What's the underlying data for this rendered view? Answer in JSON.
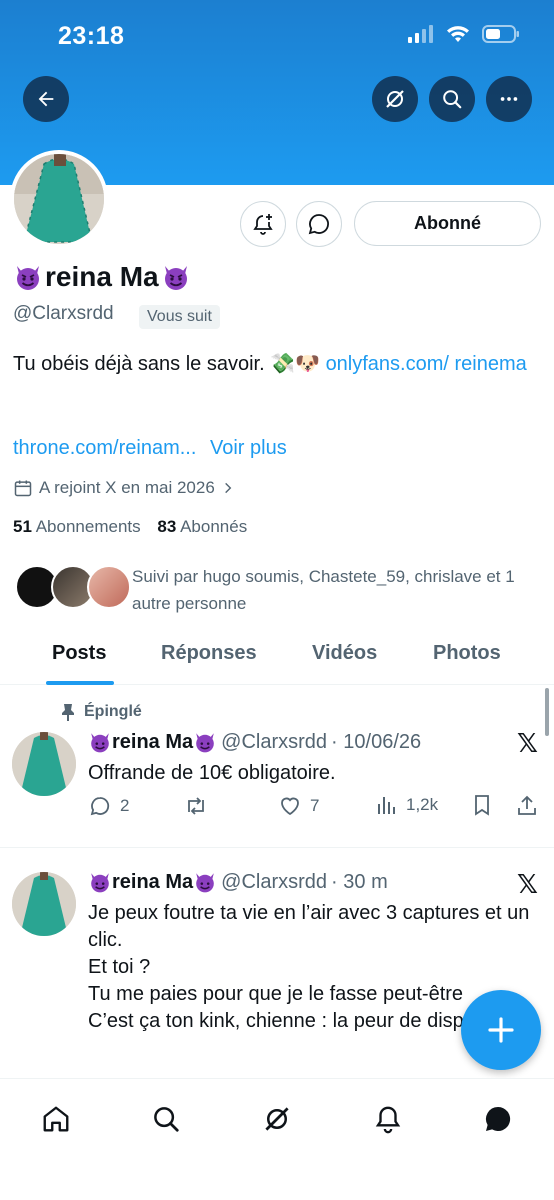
{
  "status_bar": {
    "time": "23:18"
  },
  "top_bar": {
    "back_icon": "arrow-left-icon",
    "grok_icon": "grok-icon",
    "search_icon": "search-icon",
    "more_icon": "more-icon"
  },
  "profile": {
    "display_name": "reina Ma",
    "handle": "@Clarxsrdd",
    "follows_you": "Vous suit",
    "follow_button": "Abonné",
    "bio_text": "Tu obéis déjà sans le savoir.",
    "bio_emojis": "💸🐶",
    "bio_link1": "onlyfans.com/ reinema",
    "bio_link2": "throne.com/reinam...",
    "see_more": "Voir plus",
    "joined": "A rejoint X en mai 2026",
    "following_count": "51",
    "following_label": "Abonnements",
    "followers_count": "83",
    "followers_label": "Abonnés",
    "followed_by": "Suivi par hugo soumis, Chastete_59, chrislave et 1 autre personne"
  },
  "tabs": [
    "Posts",
    "Réponses",
    "Vidéos",
    "Photos"
  ],
  "posts": [
    {
      "pinned_label": "Épinglé",
      "name": "reina Ma",
      "handle": "@Clarxsrdd",
      "time": "· 10/06/26",
      "text": "Offrande de 10€ obligatoire.",
      "replies": "2",
      "reposts": "",
      "likes": "7",
      "views": "1,2k"
    },
    {
      "name": "reina Ma",
      "handle": "@Clarxsrdd",
      "time": "· 30 m",
      "text_lines": [
        "Je peux foutre ta vie en l’air avec 3 captures et un clic.",
        "Et toi ?",
        "Tu me paies pour que je le fasse peut-être",
        "C’est ça ton kink, chienne : la peur de disparaître."
      ]
    }
  ],
  "colors": {
    "accent": "#1d9bf0",
    "banner": "#1d9bf0",
    "text": "#0f1419",
    "muted": "#536471"
  },
  "bottom_nav": [
    "home-icon",
    "search-icon",
    "grok-icon",
    "notifications-icon",
    "messages-icon"
  ]
}
